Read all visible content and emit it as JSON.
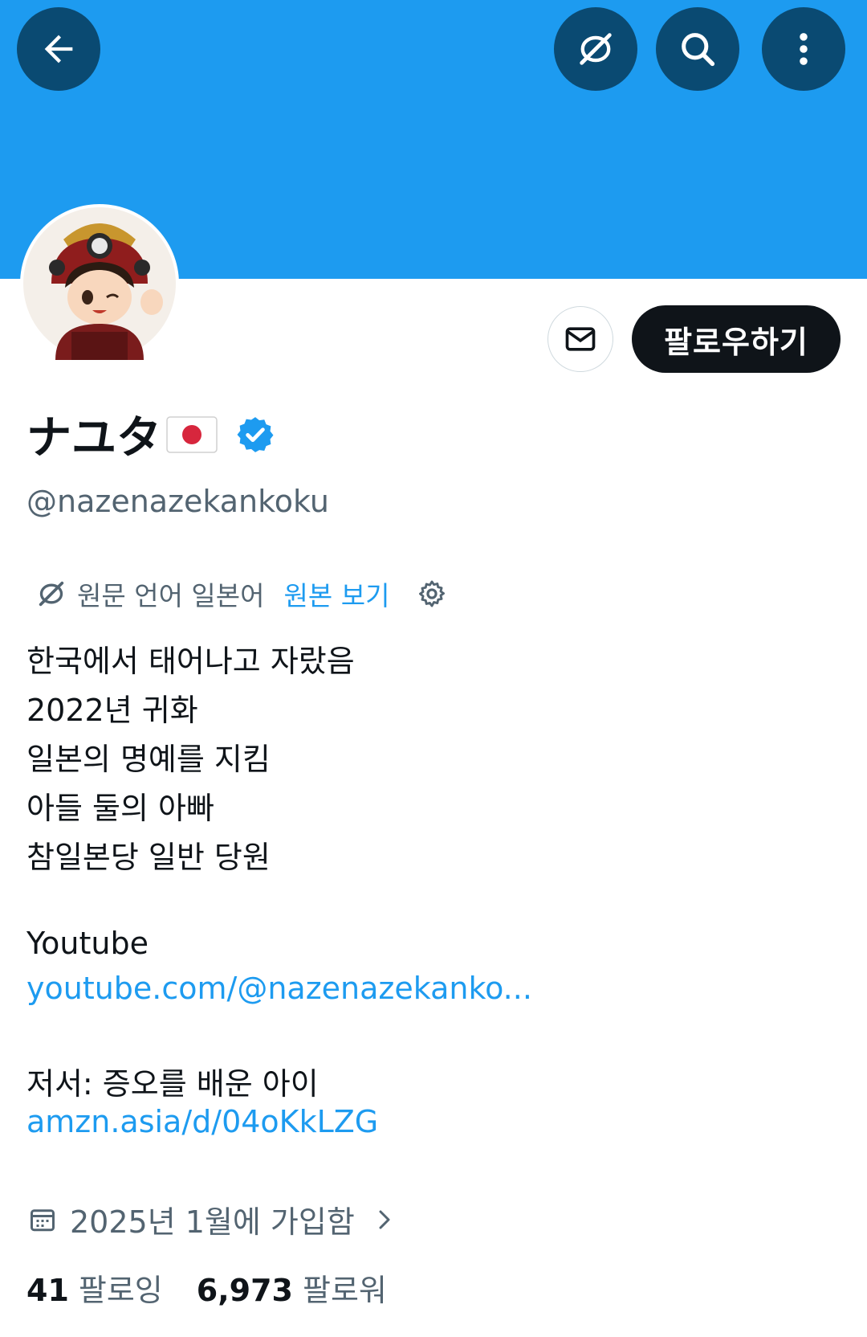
{
  "header": {
    "back_icon": "arrow-left-icon",
    "translate_icon": "translate-off-icon",
    "search_icon": "search-icon",
    "more_icon": "more-vertical-icon",
    "banner_color": "#1d9bf0"
  },
  "profile": {
    "display_name": "ナユタ",
    "flag": "japan-flag",
    "verified": true,
    "handle": "@nazenazekankoku",
    "follow_label": "팔로우하기",
    "message_icon": "envelope-icon"
  },
  "translation": {
    "source_label": "원문 언어 일본어",
    "view_original": "원본 보기"
  },
  "bio": {
    "lines": [
      "한국에서 태어나고 자랐음",
      "2022년 귀화",
      "일본의 명예를 지킴",
      "아들 둘의 아빠",
      "참일본당 일반 당원"
    ],
    "youtube_label": "Youtube",
    "youtube_link": "youtube.com/@nazenazekanko...",
    "book_label": "저서: 증오를 배운 아이",
    "book_link": "amzn.asia/d/04oKkLZG"
  },
  "joined": "2025년 1월에 가입함",
  "stats": {
    "following_count": "41",
    "following_label": "팔로잉",
    "followers_count": "6,973",
    "followers_label": "팔로워"
  }
}
